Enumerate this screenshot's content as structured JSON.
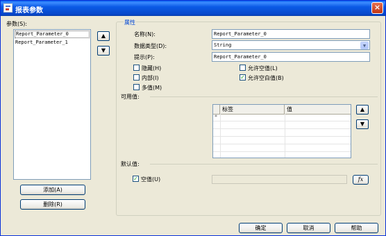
{
  "window": {
    "title": "报表参数",
    "close_symbol": "×"
  },
  "params": {
    "label": "参数(S):",
    "items": [
      {
        "label": "Report_Parameter_0",
        "selected": true
      },
      {
        "label": "Report_Parameter_1",
        "selected": false
      }
    ],
    "move_up_symbol": "▲",
    "move_down_symbol": "▼",
    "add_label": "添加(A)",
    "delete_label": "删除(R)"
  },
  "properties": {
    "group_title": "属性",
    "name_label": "名称(N):",
    "name_value": "Report_Parameter_0",
    "datatype_label": "数据类型(D):",
    "datatype_value": "String",
    "prompt_label": "提示(P):",
    "prompt_value": "Report_Parameter_0",
    "checkboxes": {
      "hidden": {
        "label": "隐藏(H)",
        "checked": false
      },
      "internal": {
        "label": "内部(I)",
        "checked": false
      },
      "multivalue": {
        "label": "多值(M)",
        "checked": false
      },
      "allow_null": {
        "label": "允许空值(L)",
        "checked": false
      },
      "allow_blank": {
        "label": "允许空白值(B)",
        "checked": true
      }
    },
    "check_mark": "✓"
  },
  "available_values": {
    "label": "可用值:",
    "columns": [
      "标签",
      "值"
    ],
    "new_row_marker": "*",
    "up_symbol": "▲",
    "down_symbol": "▼"
  },
  "default_value": {
    "label": "默认值:",
    "null_label": "空值(U)",
    "null_checked": true,
    "expression_button": "fx"
  },
  "footer": {
    "ok": "确定",
    "cancel": "取消",
    "help": "帮助"
  }
}
